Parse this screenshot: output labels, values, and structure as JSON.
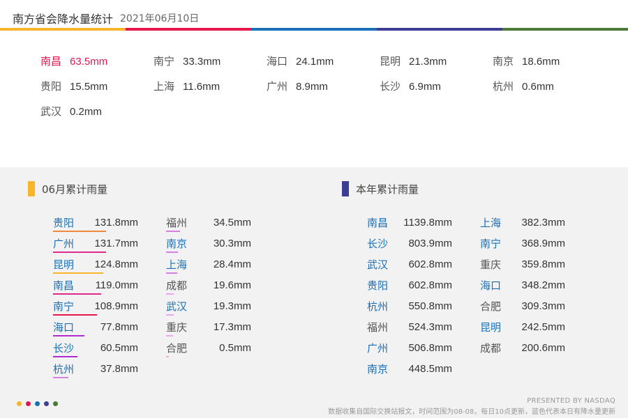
{
  "header": {
    "title": "南方省会降水量统计",
    "date": "2021年06月10日"
  },
  "colors": {
    "bar_segments": [
      "#f7b52b",
      "#e5174e",
      "#1a6fb5",
      "#3e3d96",
      "#4a7a36"
    ],
    "highlight": "#e5174e",
    "blue_text": "#1a6fb5",
    "june_marker": "#f7b52b",
    "year_marker": "#3e3d96"
  },
  "daily": [
    {
      "city": "南昌",
      "value": "63.5mm",
      "highlight": true
    },
    {
      "city": "南宁",
      "value": "33.3mm"
    },
    {
      "city": "海口",
      "value": "24.1mm"
    },
    {
      "city": "昆明",
      "value": "21.3mm"
    },
    {
      "city": "南京",
      "value": "18.6mm"
    },
    {
      "city": "贵阳",
      "value": "15.5mm"
    },
    {
      "city": "上海",
      "value": "11.6mm"
    },
    {
      "city": "广州",
      "value": "8.9mm"
    },
    {
      "city": "长沙",
      "value": "6.9mm"
    },
    {
      "city": "杭州",
      "value": "0.6mm"
    },
    {
      "city": "武汉",
      "value": "0.2mm"
    }
  ],
  "june": {
    "label": "06月累计雨量",
    "items": [
      {
        "city": "贵阳",
        "value": "131.8mm",
        "amount": 131.8,
        "color": "#f08a3a",
        "blue": true
      },
      {
        "city": "广州",
        "value": "131.7mm",
        "amount": 131.7,
        "color": "#e0288a",
        "blue": true
      },
      {
        "city": "昆明",
        "value": "124.8mm",
        "amount": 124.8,
        "color": "#f7b52b",
        "blue": true
      },
      {
        "city": "南昌",
        "value": "119.0mm",
        "amount": 119.0,
        "color": "#e0288a",
        "blue": true
      },
      {
        "city": "南宁",
        "value": "108.9mm",
        "amount": 108.9,
        "color": "#e5174e",
        "blue": true
      },
      {
        "city": "海口",
        "value": "77.8mm",
        "amount": 77.8,
        "color": "#b12bd0",
        "blue": true
      },
      {
        "city": "长沙",
        "value": "60.5mm",
        "amount": 60.5,
        "color": "#b12bd0",
        "blue": true
      },
      {
        "city": "杭州",
        "value": "37.8mm",
        "amount": 37.8,
        "color": "#d77fe0",
        "blue": true
      },
      {
        "city": "福州",
        "value": "34.5mm",
        "amount": 34.5,
        "color": "#d77fe0",
        "blue": false
      },
      {
        "city": "南京",
        "value": "30.3mm",
        "amount": 30.3,
        "color": "#d77fe0",
        "blue": true
      },
      {
        "city": "上海",
        "value": "28.4mm",
        "amount": 28.4,
        "color": "#d77fe0",
        "blue": true
      },
      {
        "city": "成都",
        "value": "19.6mm",
        "amount": 19.6,
        "color": "#e8a8ee",
        "blue": false
      },
      {
        "city": "武汉",
        "value": "19.3mm",
        "amount": 19.3,
        "color": "#e8a8ee",
        "blue": true
      },
      {
        "city": "重庆",
        "value": "17.3mm",
        "amount": 17.3,
        "color": "#e8a8ee",
        "blue": false
      },
      {
        "city": "合肥",
        "value": "0.5mm",
        "amount": 0.5,
        "color": "#e8a8ee",
        "blue": false
      }
    ]
  },
  "year": {
    "label": "本年累计雨量",
    "items": [
      {
        "city": "南昌",
        "value": "1139.8mm",
        "blue": true
      },
      {
        "city": "长沙",
        "value": "803.9mm",
        "blue": true
      },
      {
        "city": "武汉",
        "value": "602.8mm",
        "blue": true
      },
      {
        "city": "贵阳",
        "value": "602.8mm",
        "blue": true
      },
      {
        "city": "杭州",
        "value": "550.8mm",
        "blue": true
      },
      {
        "city": "福州",
        "value": "524.3mm",
        "blue": false
      },
      {
        "city": "广州",
        "value": "506.8mm",
        "blue": true
      },
      {
        "city": "南京",
        "value": "448.5mm",
        "blue": true
      },
      {
        "city": "上海",
        "value": "382.3mm",
        "blue": true
      },
      {
        "city": "南宁",
        "value": "368.9mm",
        "blue": true
      },
      {
        "city": "重庆",
        "value": "359.8mm",
        "blue": false
      },
      {
        "city": "海口",
        "value": "348.2mm",
        "blue": true
      },
      {
        "city": "合肥",
        "value": "309.3mm",
        "blue": false
      },
      {
        "city": "昆明",
        "value": "242.5mm",
        "blue": true
      },
      {
        "city": "成都",
        "value": "200.6mm",
        "blue": false
      }
    ]
  },
  "footer": {
    "credit": "PRESENTED BY NASDAQ",
    "note": "数据收集自国际交换站报文，时间范围为08-08，每日10点更新，蓝色代表本日有降水量更新"
  }
}
